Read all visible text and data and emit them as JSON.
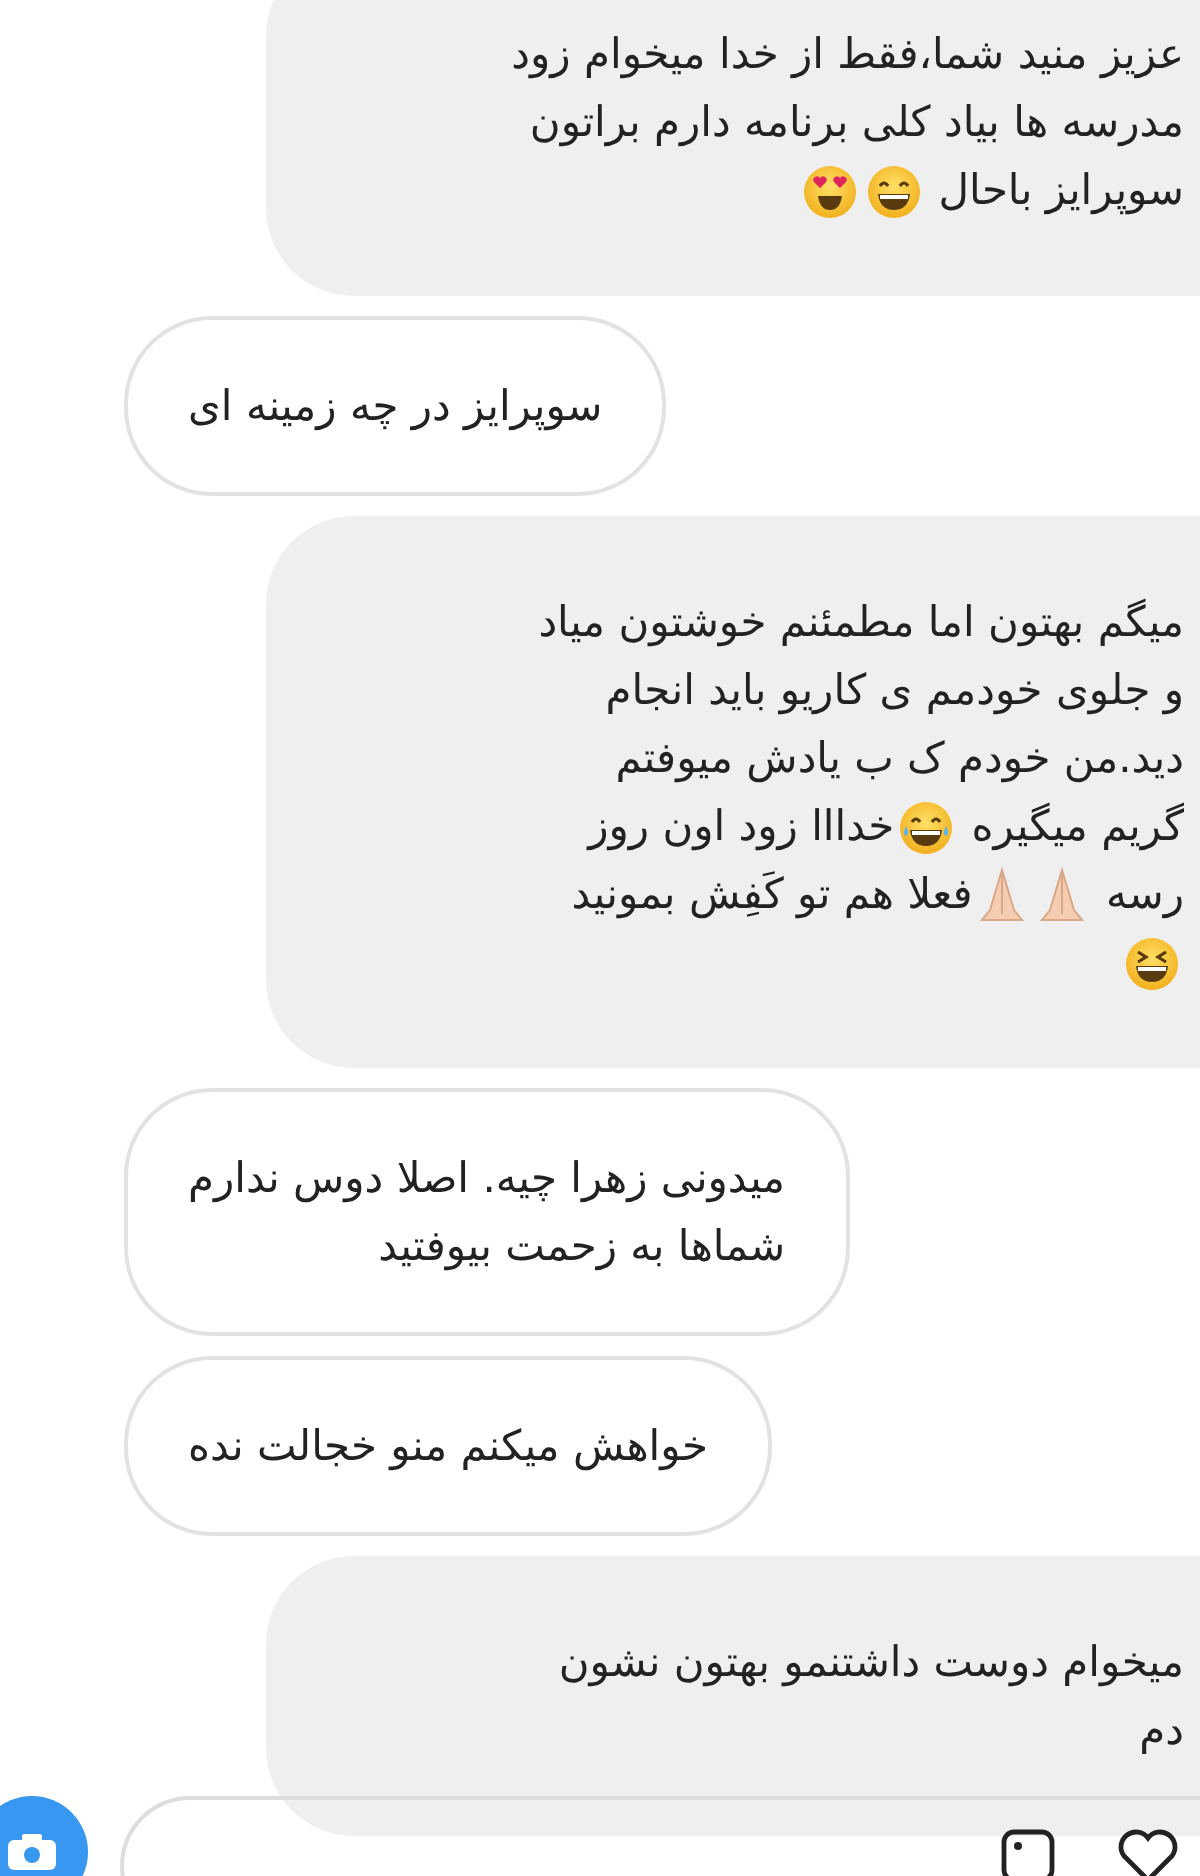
{
  "messages": [
    {
      "kind": "sent",
      "lines": [
        [
          {
            "kind": "text",
            "text": "عزیز منید شما،فقط از خدا میخوام زود"
          }
        ],
        [
          {
            "kind": "text",
            "text": "مدرسه ها بیاد کلی برنامه دارم براتون"
          }
        ],
        [
          {
            "kind": "text",
            "text": "سوپرایز باحال"
          },
          {
            "kind": "grin"
          },
          {
            "kind": "heart-eyes"
          }
        ]
      ]
    },
    {
      "kind": "received",
      "lines": [
        [
          {
            "kind": "text",
            "text": "سوپرایز در چه زمینه ای"
          }
        ]
      ]
    },
    {
      "kind": "sent",
      "lines": [
        [
          {
            "kind": "text",
            "text": "میگم بهتون اما مطمئنم خوشتون میاد"
          }
        ],
        [
          {
            "kind": "text",
            "text": "و جلوی خودمم ی کاریو باید انجام"
          }
        ],
        [
          {
            "kind": "text",
            "text": "دید.من خودم ک ب یادش میوفتم"
          }
        ],
        [
          {
            "kind": "text",
            "text": "گریم میگیره"
          },
          {
            "kind": "tears"
          },
          {
            "kind": "text",
            "text": "خدااا زود اون روز"
          }
        ],
        [
          {
            "kind": "text",
            "text": "رسه"
          },
          {
            "kind": "pray"
          },
          {
            "kind": "pray"
          },
          {
            "kind": "text",
            "text": "فعلا هم تو کَفِش بمونید"
          }
        ],
        [
          {
            "kind": "squint"
          }
        ]
      ]
    },
    {
      "kind": "received",
      "lines": [
        [
          {
            "kind": "text",
            "text": "میدونی زهرا چیه. اصلا دوس ندارم"
          }
        ],
        [
          {
            "kind": "text",
            "text": "شماها به زحمت بیوفتید"
          }
        ]
      ]
    },
    {
      "kind": "received",
      "lines": [
        [
          {
            "kind": "text",
            "text": "خواهش میکنم منو خجالت نده"
          }
        ]
      ]
    },
    {
      "kind": "sent",
      "lines": [
        [
          {
            "kind": "text",
            "text": "میخوام دوست داشتنمو بهتون نشون"
          }
        ],
        [
          {
            "kind": "text",
            "text": "دم"
          }
        ]
      ]
    }
  ]
}
